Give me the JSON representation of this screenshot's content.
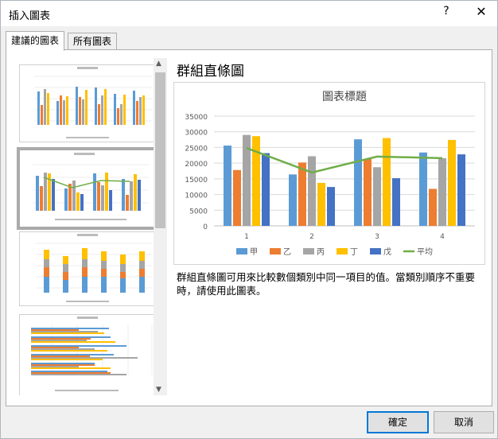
{
  "dialog": {
    "title": "插入圖表",
    "help": "?",
    "close": "✕"
  },
  "tabs": [
    {
      "label": "建議的圖表"
    },
    {
      "label": "所有圖表"
    }
  ],
  "scroll": {
    "up": "▲",
    "down": "▼"
  },
  "main": {
    "heading": "群組直條圖",
    "description": "群組直條圖可用來比較數個類別中同一項目的值。當類別順序不重要時，請使用此圖表。"
  },
  "buttons": {
    "ok": "確定",
    "cancel": "取消"
  },
  "colors": {
    "s1": "#5b9bd5",
    "s2": "#ed7d31",
    "s3": "#a5a5a5",
    "s4": "#ffc000",
    "s5": "#4472c4",
    "avg": "#70ad47"
  },
  "chart_data": {
    "type": "bar",
    "title": "圖表標題",
    "categories": [
      "1",
      "2",
      "3",
      "4"
    ],
    "series": [
      {
        "name": "甲",
        "values": [
          25600,
          16400,
          27600,
          23400
        ]
      },
      {
        "name": "乙",
        "values": [
          17800,
          20200,
          21300,
          11800
        ]
      },
      {
        "name": "丙",
        "values": [
          29000,
          22200,
          18700,
          21600
        ]
      },
      {
        "name": "丁",
        "values": [
          28600,
          13700,
          28000,
          27400
        ]
      },
      {
        "name": "戊",
        "values": [
          23200,
          12400,
          15200,
          22800
        ]
      }
    ],
    "line": {
      "name": "平均",
      "values": [
        24800,
        17000,
        22100,
        21600
      ]
    },
    "ylim": [
      0,
      35000
    ],
    "yticks": [
      "0",
      "5000",
      "10000",
      "15000",
      "20000",
      "25000",
      "30000",
      "35000"
    ],
    "legend": "bottom",
    "grid": true
  }
}
